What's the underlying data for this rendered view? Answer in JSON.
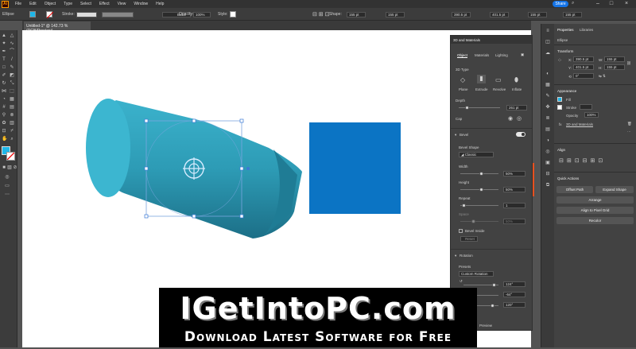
{
  "app": {
    "logo": "Ai"
  },
  "menu": [
    "File",
    "Edit",
    "Object",
    "Type",
    "Select",
    "Effect",
    "View",
    "Window",
    "Help"
  ],
  "header": {
    "share": "Share"
  },
  "control": {
    "object": "Ellipse",
    "stroke_label": "Stroke:",
    "brush": "Basic",
    "opacity_label": "Opacity:",
    "opacity": "100%",
    "style_label": "Style:",
    "shape_label": "Shape:",
    "width": "155 pt",
    "height": "155 pt",
    "x": "390.5 pt",
    "y": "401.5 pt",
    "w2": "155 pt",
    "h2": "155 pt"
  },
  "document": {
    "tab": "Untitled-1* @ 142.73 % (RGB/Preview)"
  },
  "panel3d": {
    "title": "3D and Materials",
    "tabs": [
      "Object",
      "Materials",
      "Lighting"
    ],
    "type_label": "3D Type",
    "types": [
      "Plane",
      "Extrude",
      "Revolve",
      "Inflate"
    ],
    "depth_label": "Depth",
    "depth": "261 pt",
    "cap_label": "Cap",
    "bevel_label": "Bevel",
    "bevel_shape_label": "Bevel Shape",
    "bevel_shape": "Classic",
    "width_label": "Width",
    "width": "50%",
    "height_label": "Height",
    "height": "50%",
    "repeat_label": "Repeat",
    "repeat": "1",
    "space_label": "Space",
    "space": "50%",
    "bevel_inside": "Bevel Inside",
    "reset": "Reset",
    "rotation_label": "Rotation",
    "presets_label": "Presets",
    "preset": "Custom Rotation",
    "rot_x": "124°",
    "rot_y": "-64°",
    "rot_z": "120°",
    "render_label": "Preview"
  },
  "properties": {
    "tabs": [
      "Properties",
      "Libraries"
    ],
    "object": "Ellipse",
    "transform_label": "Transform",
    "x_label": "X:",
    "x": "390.5 pt",
    "y_label": "Y:",
    "y": "401.5 pt",
    "w_label": "W:",
    "w": "155 pt",
    "h_label": "H:",
    "h": "155 pt",
    "rotate": "0°",
    "appearance_label": "Appearance",
    "fill_label": "Fill",
    "stroke_label": "Stroke",
    "opacity_label": "Opacity",
    "opacity": "100%",
    "fx_label": "fx",
    "effect": "3D and Materials",
    "align_label": "Align",
    "quick_actions_label": "Quick Actions",
    "offset_path": "Offset Path",
    "expand_shape": "Expand Shape",
    "arrange": "Arrange",
    "align_pixel": "Align to Pixel Grid",
    "recolor": "Recolor"
  },
  "watermark": {
    "title": "IGetIntoPC.com",
    "subtitle": "Download Latest Software for Free"
  },
  "colors": {
    "accent": "#1473e6",
    "cylinder": "#2d9bb5",
    "square": "#0b74c4",
    "fill_swatch": "#1fb6e8"
  }
}
